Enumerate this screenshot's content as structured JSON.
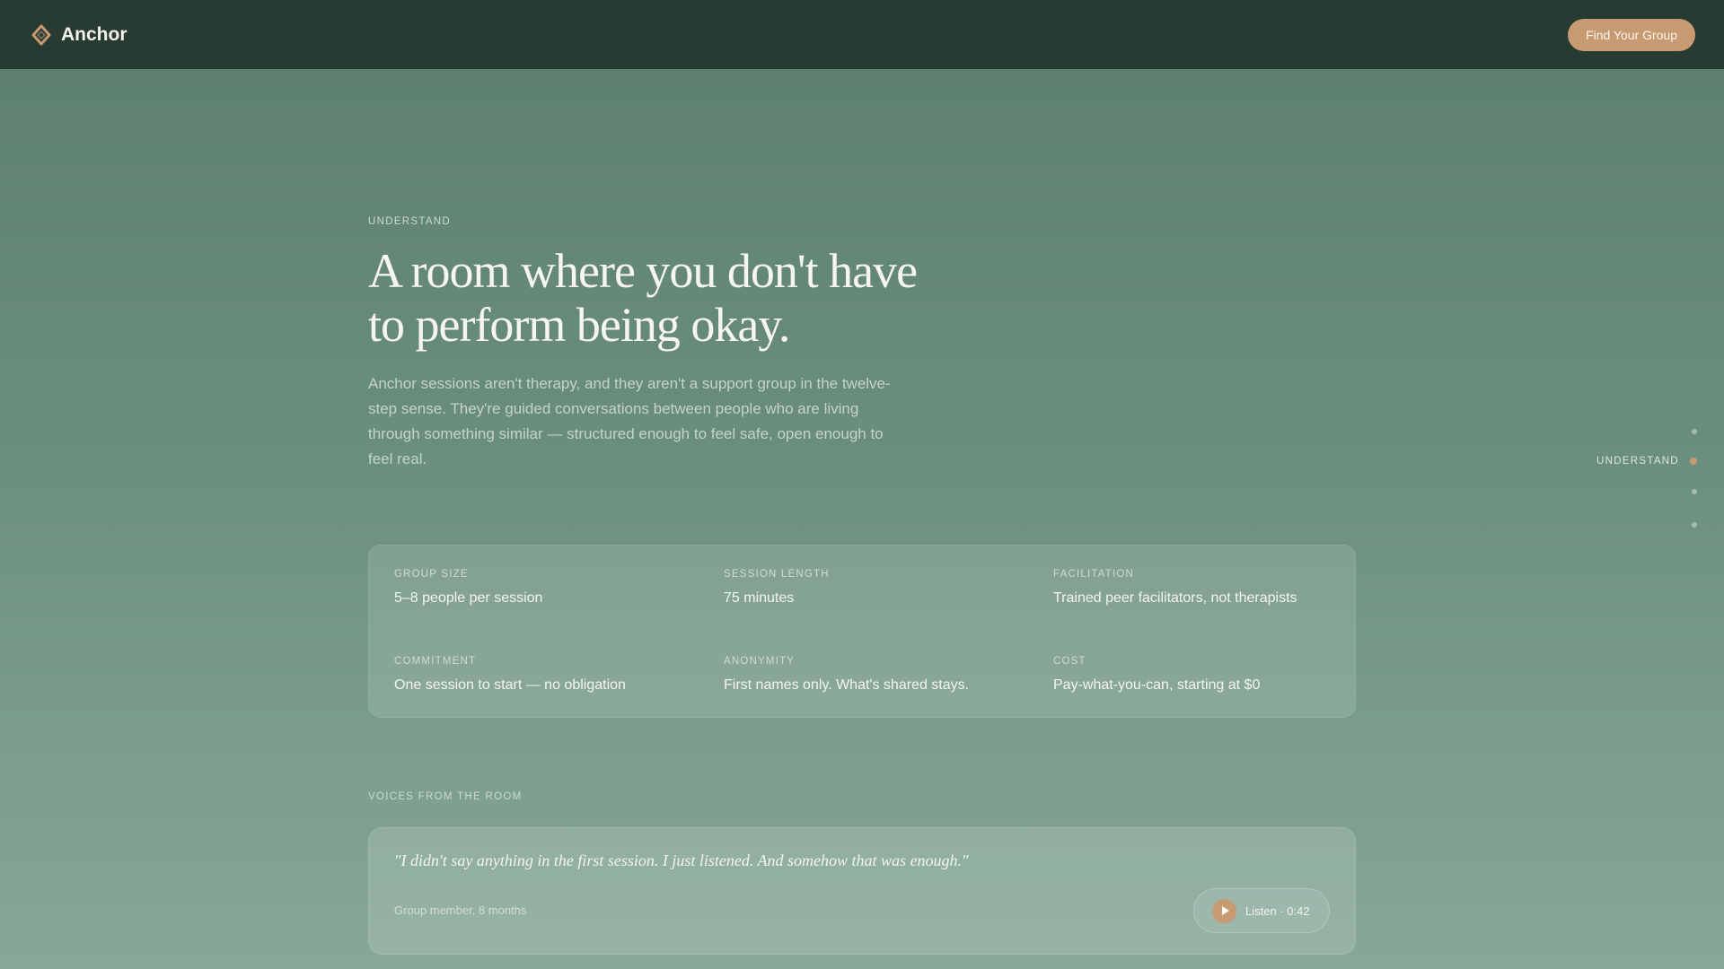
{
  "header": {
    "brand_name": "Anchor",
    "logo_icon": "anchor-knot-icon",
    "cta_label": "Find Your Group"
  },
  "hero": {
    "eyebrow": "UNDERSTAND",
    "headline": "A room where you don't have to perform being okay.",
    "intro": "Anchor sessions aren't therapy, and they aren't a support group in the twelve-step sense. They're guided conversations between people who are living through something similar — structured enough to feel safe, open enough to feel real."
  },
  "facts": [
    {
      "label": "GROUP SIZE",
      "value": "5–8 people per session"
    },
    {
      "label": "SESSION LENGTH",
      "value": "75 minutes"
    },
    {
      "label": "FACILITATION",
      "value": "Trained peer facilitators, not therapists"
    },
    {
      "label": "COMMITMENT",
      "value": "One session to start — no obligation"
    },
    {
      "label": "ANONYMITY",
      "value": "First names only. What's shared stays."
    },
    {
      "label": "COST",
      "value": "Pay-what-you-can, starting at $0"
    }
  ],
  "voices": {
    "eyebrow": "VOICES FROM THE ROOM",
    "quote": "\"I didn't say anything in the first session. I just listened. And somehow that was enough.\"",
    "attribution": "Group member, 8 months",
    "listen_label": "Listen · 0:42",
    "play_icon": "play-icon"
  },
  "section_nav": {
    "active_label": "UNDERSTAND",
    "active_index": 1,
    "count": 4
  },
  "colors": {
    "header_bg": "#283b33",
    "accent": "#c79a72",
    "page_bg_top": "#5b7e6f",
    "page_bg_bottom": "#86a898"
  }
}
